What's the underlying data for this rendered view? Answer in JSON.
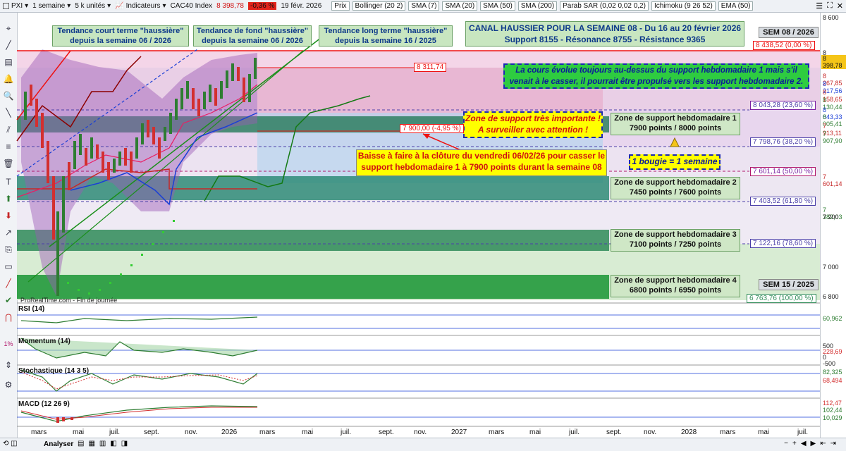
{
  "toolbar": {
    "symbol": "PXI",
    "period": "1 semaine",
    "units": "5 k unités",
    "indicators_label": "Indicateurs",
    "instrument": "CAC40 Index",
    "last_price": "8 398,78",
    "change": "-0,36 %",
    "date": "19 févr. 2026",
    "overlays": [
      "Prix",
      "Bollinger (20 2)",
      "SMA (7)",
      "SMA (20)",
      "SMA (50)",
      "SMA (200)",
      "Parab SAR (0,02 0,02 0,2)",
      "Ichimoku (9 26 52)",
      "EMA (50)"
    ]
  },
  "annotations": {
    "trend_short": "Tendance court terme \"haussière\" depuis la semaine 06 / 2026",
    "trend_base": "Tendance de fond \"haussière\" depuis la semaine 06 / 2026",
    "trend_long": "Tendance long terme \"haussière\" depuis la semaine 16 / 2025",
    "channel_title": "CANAL HAUSSIER POUR LA SEMAINE 08 - Du 16 au 20 février 2026",
    "channel_sub": "Support 8155 - Résonance 8755 - Résistance 9365",
    "week_top": "SEM 08 / 2026",
    "week_bottom": "SEM 15 / 2025",
    "note_blue": "La cours évolue toujours au-dessus du support hebdomadaire 1 mais s'il venait à le casser, il pourrait être propulsé vers les support hebdomadaire 2.",
    "note_zone": "Zone de support très importante ! A surveiller avec attention !",
    "note_red": "Baisse à faire à la clôture du vendredi 06/02/26 pour casser le support hebdomadaire 1 à 7900 points durant la semaine 08",
    "note_candle": "1 bougie = 1 semaine",
    "level_8311": "8 311,74",
    "level_7900": "7 900,00 (-4,95 %)",
    "source": "ProRealTime.com - Fin de journée"
  },
  "zones": [
    {
      "title": "Zone de support hebdomadaire 1",
      "range": "7900 points / 8000 points"
    },
    {
      "title": "Zone de support hebdomadaire 2",
      "range": "7450 points / 7600 points"
    },
    {
      "title": "Zone de support hebdomadaire 3",
      "range": "7100 points / 7250 points"
    },
    {
      "title": "Zone de support hebdomadaire 4",
      "range": "6800 points / 6950 points"
    }
  ],
  "fib_levels": [
    "8 438,52 (0,00 %)",
    "8 043,28 (23,60 %)",
    "7 798,76 (38,20 %)",
    "7 601,14 (50,00 %)",
    "7 403,52 (61,80 %)",
    "7 122,16 (78,60 %)",
    "6 763,76 (100,00 %)"
  ],
  "price_axis": [
    "8 600",
    "8 404,19",
    "8 398,78",
    "8 267,85",
    "8 217,56",
    "8 158,65",
    "8 130,44",
    "8 043,33",
    "8 005,41",
    "7 913,11",
    "7 907,90",
    "7 601,14",
    "7 382,03",
    "7 200",
    "7 000",
    "6 800"
  ],
  "x_axis": [
    "mars",
    "mai",
    "juil.",
    "sept.",
    "nov.",
    "2026",
    "mars",
    "mai",
    "juil.",
    "sept.",
    "nov.",
    "2027",
    "mars",
    "mai",
    "juil.",
    "sept.",
    "nov.",
    "2028",
    "mars",
    "mai",
    "juil."
  ],
  "panels": {
    "rsi": {
      "label": "RSI (14)",
      "value": "60,962"
    },
    "momentum": {
      "label": "Momentum (14)",
      "ticks": [
        "500",
        "0",
        "-500"
      ],
      "value": "228,69"
    },
    "stochastic": {
      "label": "Stochastique (14 3 5)",
      "values": [
        "82,325",
        "68,494"
      ]
    },
    "macd": {
      "label": "MACD (12 26 9)",
      "values": [
        "112,47",
        "102,44",
        "10,029"
      ]
    }
  },
  "bottom": {
    "analyser": "Analyser"
  },
  "colors": {
    "price_up": "#2e7d32",
    "price_down": "#d32f2f",
    "channel_line": "#1a8f1a",
    "fib": "#7a1fa2",
    "zone": "#2e8b57"
  }
}
